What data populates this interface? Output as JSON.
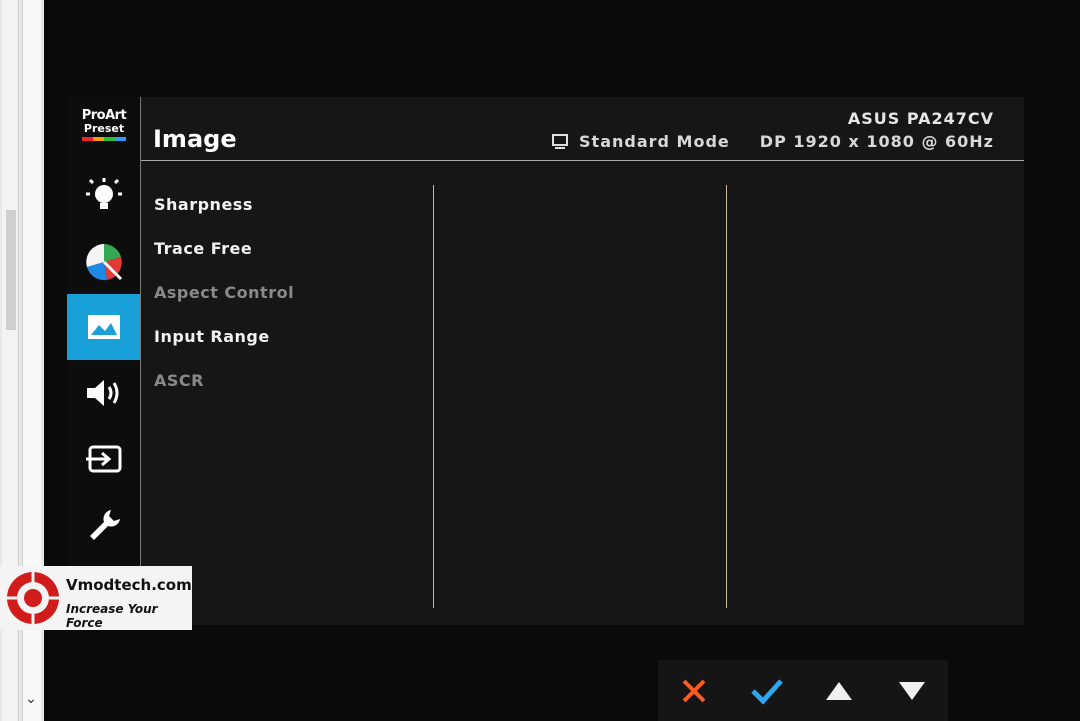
{
  "osd": {
    "brand": {
      "line1": "ProArt",
      "line2": "Preset"
    },
    "title": "Image",
    "model": "ASUS PA247CV",
    "mode": "Standard Mode",
    "signal": "DP  1920 x 1080 @ 60Hz",
    "active_category": "image",
    "menu": [
      {
        "label": "Sharpness",
        "enabled": true
      },
      {
        "label": "Trace Free",
        "enabled": true
      },
      {
        "label": "Aspect Control",
        "enabled": false
      },
      {
        "label": "Input Range",
        "enabled": true
      },
      {
        "label": "ASCR",
        "enabled": false
      }
    ]
  },
  "watermark": {
    "site": "Vmodtech.com",
    "tagline": "Increase Your Force"
  },
  "keys": [
    "close-icon",
    "check-icon",
    "up-arrow-icon",
    "down-arrow-icon"
  ],
  "colors": {
    "accent": "#1aa0d8",
    "close": "#ff5a1f",
    "check": "#2aa7f0"
  }
}
